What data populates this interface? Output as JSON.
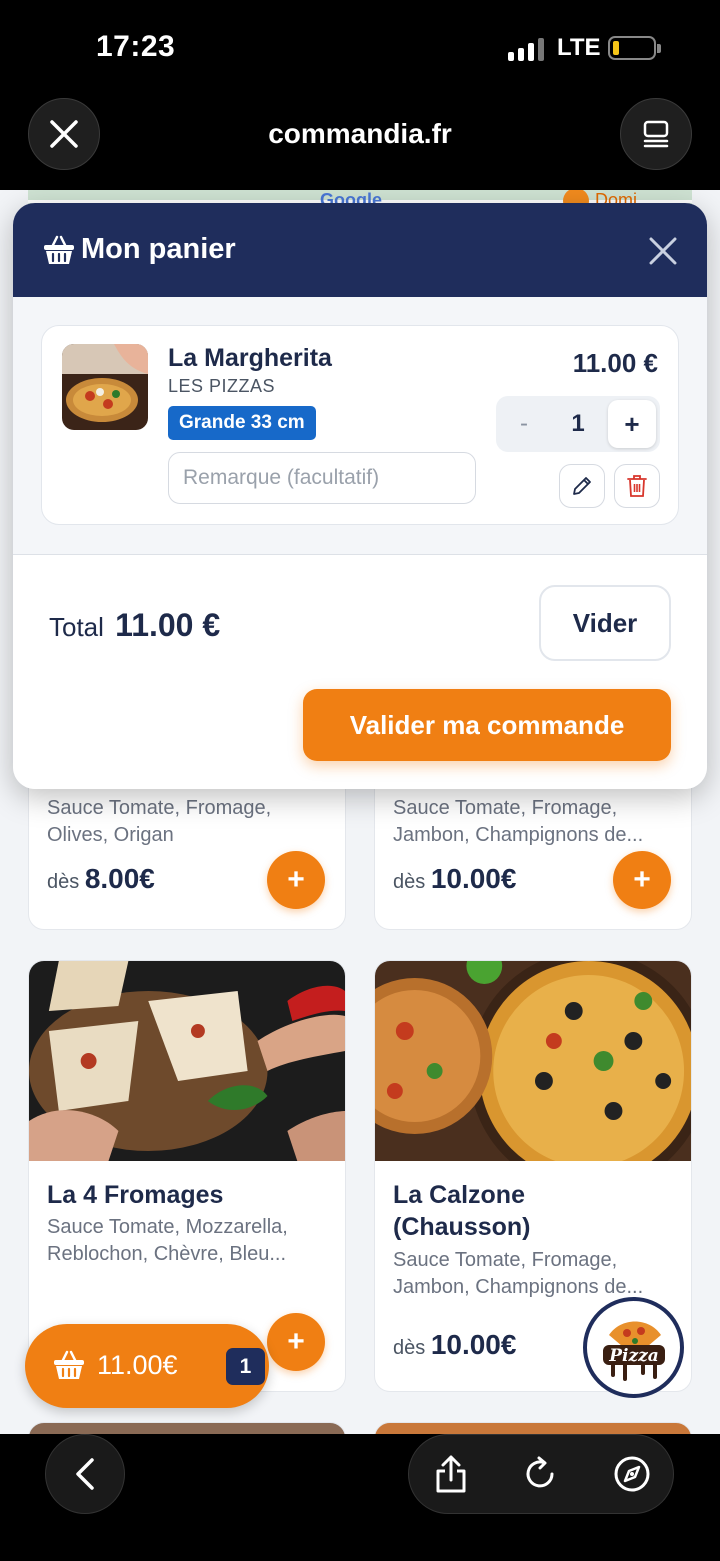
{
  "status_bar": {
    "time": "17:23",
    "network": "LTE"
  },
  "browser": {
    "url": "commandia.fr"
  },
  "cart": {
    "title": "Mon panier",
    "item": {
      "name": "La Margherita",
      "category": "LES PIZZAS",
      "size": "Grande 33 cm",
      "price": "11.00 €",
      "quantity": "1",
      "minus_label": "-",
      "plus_label": "+",
      "remark_placeholder": "Remarque (facultatif)"
    },
    "total_label": "Total",
    "total_value": "11.00 €",
    "clear_label": "Vider",
    "checkout_label": "Valider ma commande"
  },
  "products": [
    {
      "desc": "Sauce Tomate, Fromage,\nOlives, Origan",
      "price_prefix": "dès",
      "price": "8.00€"
    },
    {
      "desc": "Sauce Tomate, Fromage,\nJambon, Champignons de...",
      "price_prefix": "dès",
      "price": "10.00€"
    },
    {
      "name": "La 4 Fromages",
      "desc": "Sauce Tomate, Mozzarella,\nReblochon, Chèvre, Bleu..."
    },
    {
      "name": "La Calzone\n(Chausson)",
      "desc": "Sauce Tomate, Fromage,\nJambon, Champignons de...",
      "price_prefix": "dès",
      "price": "10.00€"
    }
  ],
  "add_label": "+",
  "floating_cart": {
    "total": "11.00€",
    "count": "1"
  },
  "colors": {
    "navy": "#1f2d5c",
    "orange": "#f07f13",
    "blue_badge": "#1769c9"
  },
  "icons": [
    "close-icon",
    "tabs-icon",
    "basket-icon",
    "pencil-icon",
    "trash-icon",
    "back-chevron-icon",
    "share-icon",
    "reload-icon",
    "compass-icon"
  ]
}
